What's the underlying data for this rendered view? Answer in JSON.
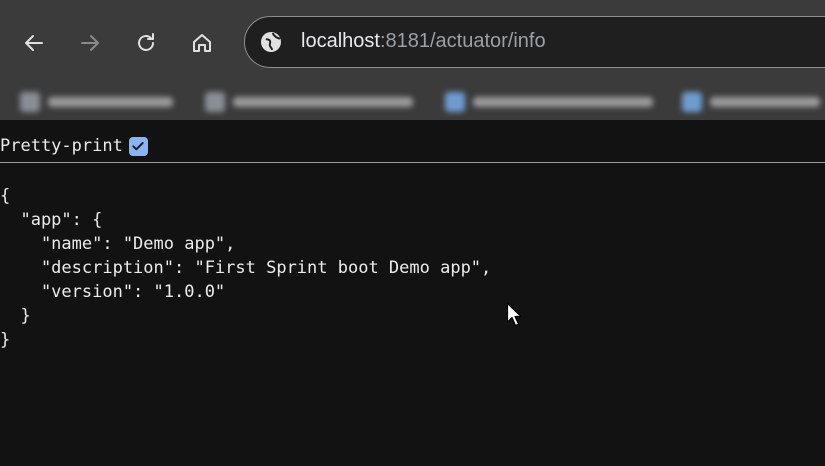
{
  "browser": {
    "url_host": "localhost",
    "url_rest": ":8181/actuator/info",
    "icons": {
      "back": "arrow-left-icon",
      "forward": "arrow-right-icon",
      "reload": "reload-icon",
      "home": "home-icon",
      "site_info": "site-info-icon"
    }
  },
  "page": {
    "pretty_print_label": "Pretty-print",
    "pretty_print_checked": true,
    "json_lines": [
      "{",
      "  \"app\": {",
      "    \"name\": \"Demo app\",",
      "    \"description\": \"First Sprint boot Demo app\",",
      "    \"version\": \"1.0.0\"",
      "  }",
      "}"
    ]
  },
  "colors": {
    "toolbar": "#3b3b3b",
    "page_bg": "#121212",
    "checkbox": "#8ab4f8",
    "text": "#ececec"
  }
}
